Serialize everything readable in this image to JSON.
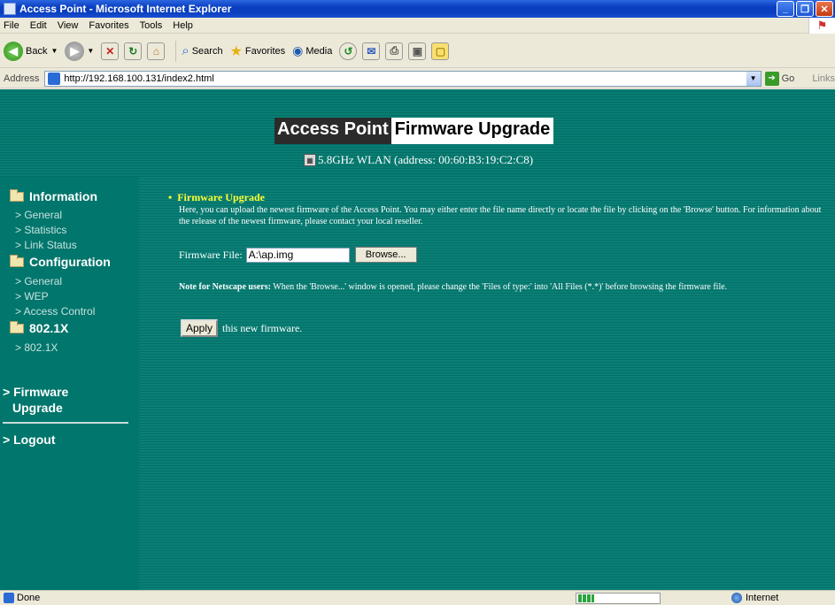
{
  "window": {
    "title": "Access Point - Microsoft Internet Explorer"
  },
  "menu": [
    "File",
    "Edit",
    "View",
    "Favorites",
    "Tools",
    "Help"
  ],
  "toolbar": {
    "back": "Back",
    "search": "Search",
    "favorites": "Favorites",
    "media": "Media"
  },
  "address": {
    "label": "Address",
    "url": "http://192.168.100.131/index2.html",
    "go": "Go",
    "links": "Links"
  },
  "banner": {
    "dark": "Access Point",
    "light": "Firmware Upgrade",
    "wlan": "5.8GHz WLAN (address: 00:60:B3:19:C2:C8)"
  },
  "sidebar": {
    "information": {
      "title": "Information",
      "items": [
        "> General",
        "> Statistics",
        "> Link Status"
      ]
    },
    "configuration": {
      "title": "Configuration",
      "items": [
        "> General",
        "> WEP",
        "> Access Control"
      ]
    },
    "dot1x": {
      "title": "802.1X",
      "items": [
        "> 802.1X"
      ]
    },
    "firmware_line1": "> Firmware",
    "firmware_line2": "Upgrade",
    "logout": "> Logout"
  },
  "content": {
    "bullet": "•",
    "title": "Firmware Upgrade",
    "description": "Here, you can upload the newest firmware of the Access Point. You may either enter the file name directly or locate the file by clicking on the 'Browse' button. For information about the release of the newest firmware, please contact your local reseller.",
    "file_label": "Firmware File:",
    "file_value": "A:\\ap.img",
    "browse": "Browse...",
    "note_bold": "Note for Netscape users:",
    "note_text": " When the 'Browse...' window is opened, please change the 'Files of type:' into 'All Files (*.*)' before browsing the firmware file.",
    "apply": "Apply",
    "apply_suffix": "this new firmware."
  },
  "status": {
    "text": "Done",
    "zone": "Internet",
    "progress": 0.2
  }
}
